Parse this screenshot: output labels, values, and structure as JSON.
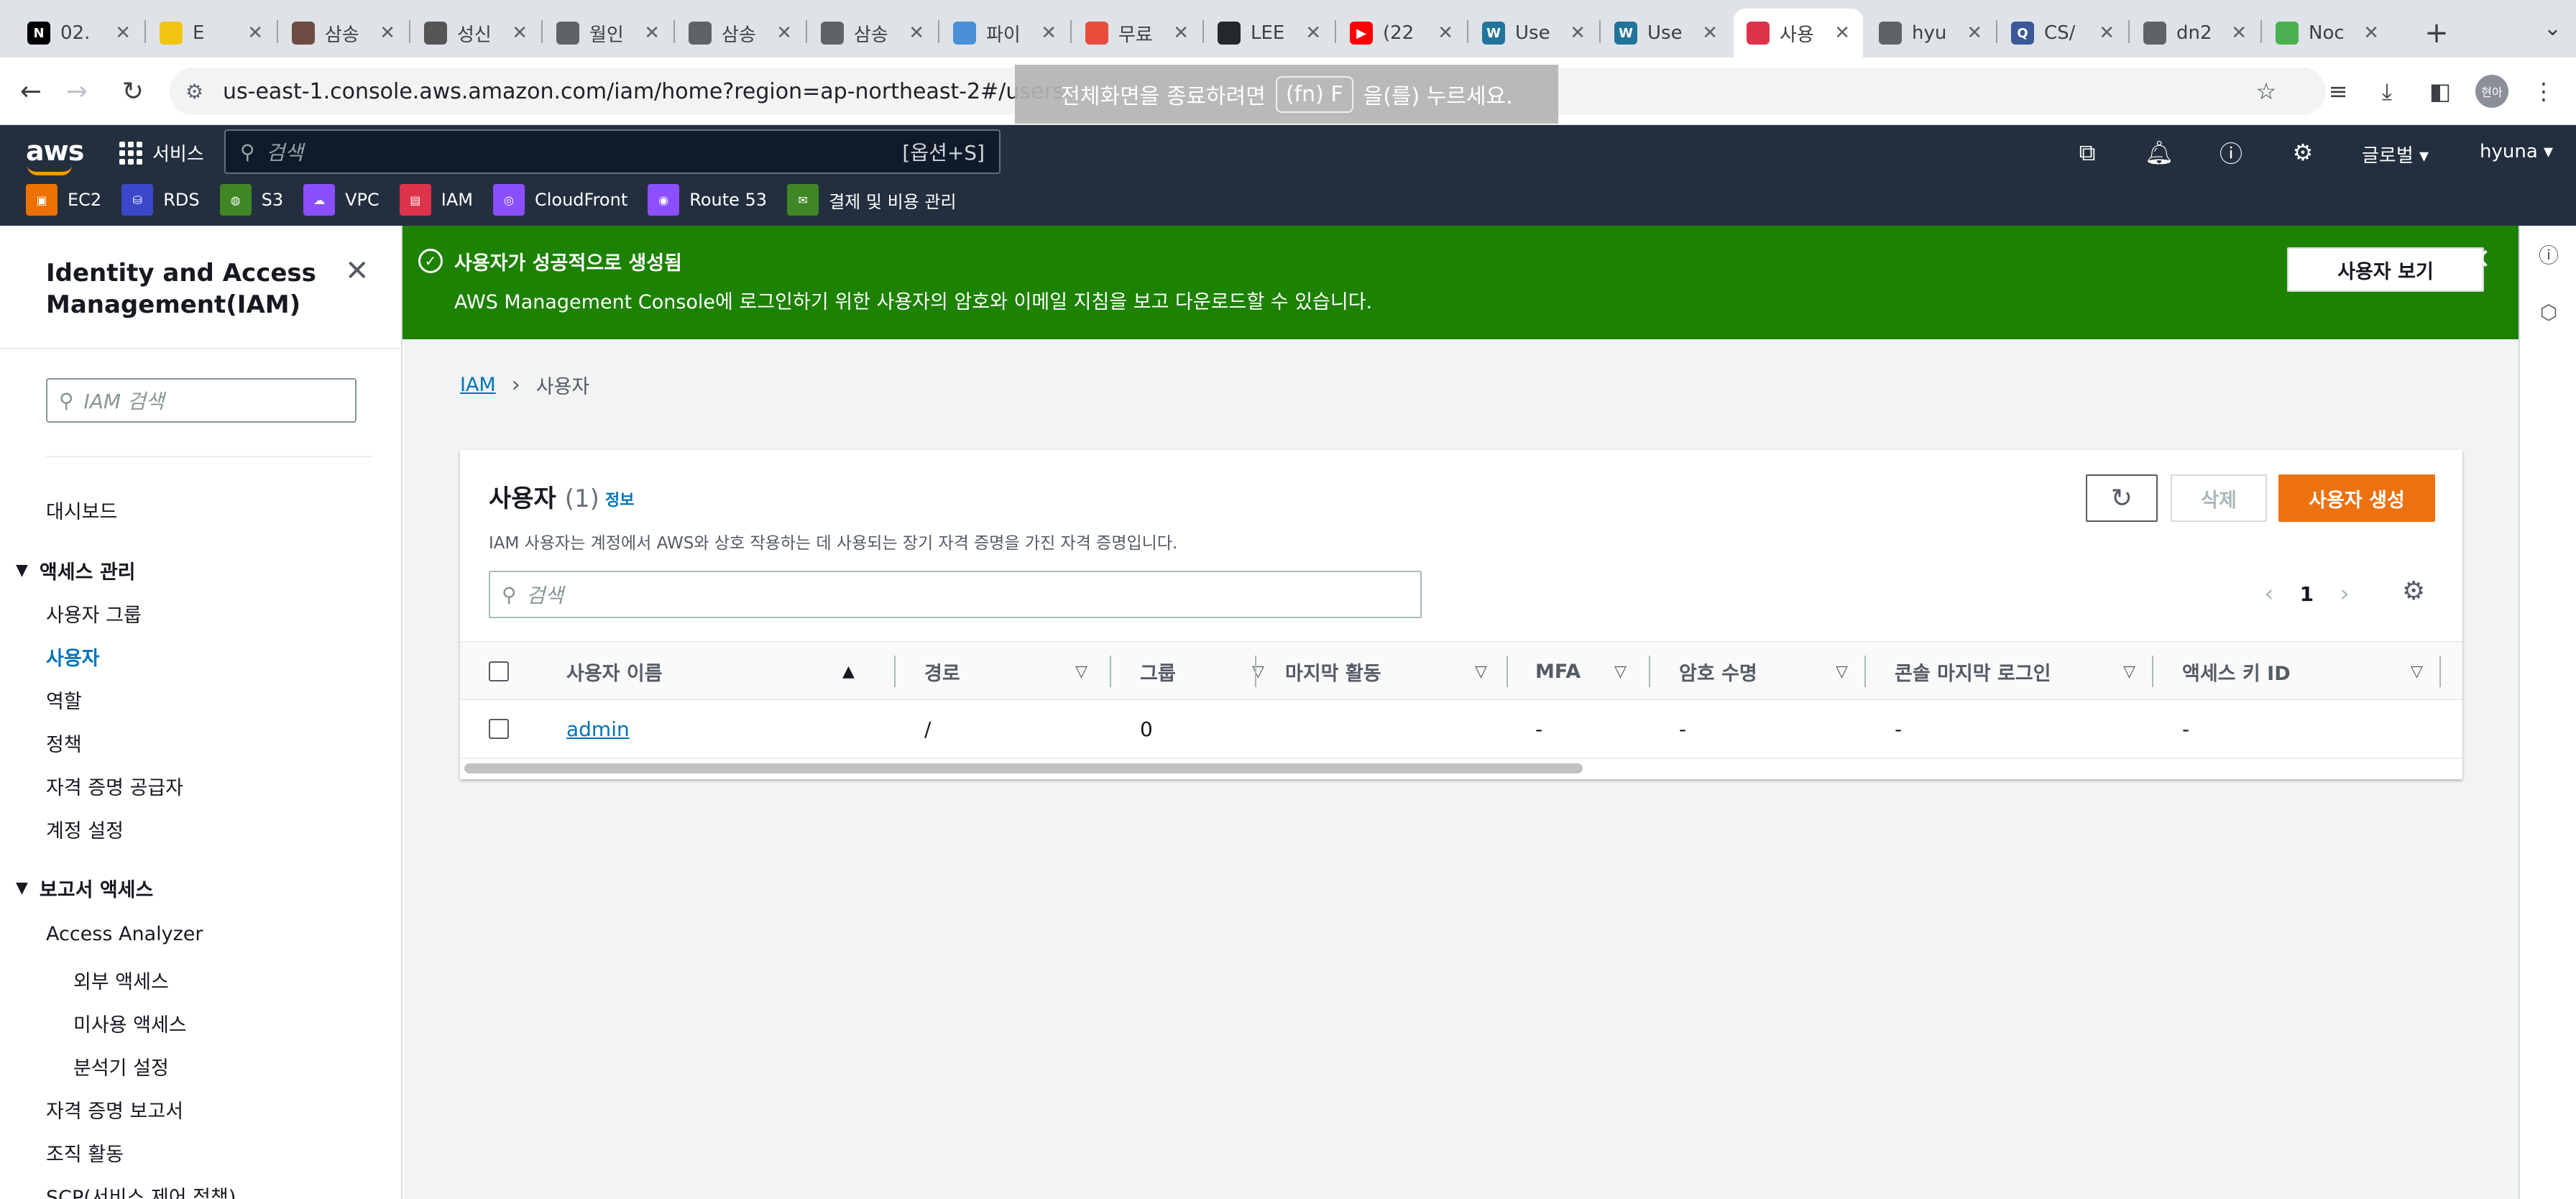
{
  "browser": {
    "tabs": [
      {
        "title": "02.",
        "icon_color": "#000000",
        "icon_label": "N"
      },
      {
        "title": "E",
        "icon_color": "#f1c40f",
        "icon_label": ""
      },
      {
        "title": "삼송",
        "icon_color": "#6d4c41",
        "icon_label": ""
      },
      {
        "title": "성신",
        "icon_color": "#555555",
        "icon_label": ""
      },
      {
        "title": "월인",
        "icon_color": "#5f6368",
        "icon_label": ""
      },
      {
        "title": "삼송",
        "icon_color": "#5f6368",
        "icon_label": ""
      },
      {
        "title": "삼송",
        "icon_color": "#5f6368",
        "icon_label": ""
      },
      {
        "title": "파이",
        "icon_color": "#4a90d9",
        "icon_label": ""
      },
      {
        "title": "무료",
        "icon_color": "#e74c3c",
        "icon_label": ""
      },
      {
        "title": "LEE",
        "icon_color": "#24292e",
        "icon_label": ""
      },
      {
        "title": "(22",
        "icon_color": "#ff0000",
        "icon_label": "▶"
      },
      {
        "title": "Use",
        "icon_color": "#21759b",
        "icon_label": "W"
      },
      {
        "title": "Use",
        "icon_color": "#21759b",
        "icon_label": "W"
      },
      {
        "title": "사용",
        "icon_color": "#dd344c",
        "icon_label": ""
      },
      {
        "title": "hyu",
        "icon_color": "#5f6368",
        "icon_label": ""
      },
      {
        "title": "CS/",
        "icon_color": "#3b5998",
        "icon_label": "Q"
      },
      {
        "title": "dn2",
        "icon_color": "#5f6368",
        "icon_label": ""
      },
      {
        "title": "Noc",
        "icon_color": "#4caf50",
        "icon_label": ""
      }
    ],
    "new_tab_label": "+",
    "url": "us-east-1.console.aws.amazon.com/iam/home?region=ap-northeast-2#/users",
    "fullscreen_hint": {
      "before": "전체화면을 종료하려면",
      "key": "(fn) F",
      "after": "을(를) 누르세요."
    },
    "profile_initials": "현아"
  },
  "aws_nav": {
    "logo": "aws",
    "services_label": "서비스",
    "search_placeholder": "검색",
    "search_shortcut": "[옵션+S]",
    "region_label": "글로벌",
    "user_label": "hyuna",
    "favorites": [
      {
        "label": "EC2",
        "color": "#ed7100"
      },
      {
        "label": "RDS",
        "color": "#3b48cc"
      },
      {
        "label": "S3",
        "color": "#3f8624"
      },
      {
        "label": "VPC",
        "color": "#8c4fff"
      },
      {
        "label": "IAM",
        "color": "#dd344c"
      },
      {
        "label": "CloudFront",
        "color": "#8c4fff"
      },
      {
        "label": "Route 53",
        "color": "#8c4fff"
      },
      {
        "label": "결제 및 비용 관리",
        "color": "#3f8624"
      }
    ]
  },
  "sidebar": {
    "title": "Identity and Access Management(IAM)",
    "search_placeholder": "IAM 검색",
    "dashboard": "대시보드",
    "access_section": "액세스 관리",
    "access_items": [
      "사용자 그룹",
      "사용자",
      "역할",
      "정책",
      "자격 증명 공급자",
      "계정 설정"
    ],
    "active_item": "사용자",
    "reports_section": "보고서 액세스",
    "access_analyzer": "Access Analyzer",
    "analyzer_items": [
      "외부 액세스",
      "미사용 액세스",
      "분석기 설정"
    ],
    "more_items": [
      "자격 증명 보고서",
      "조직 활동",
      "SCP(서비스 제어 정책)"
    ]
  },
  "flash": {
    "title": "사용자가 성공적으로 생성됨",
    "message": "AWS Management Console에 로그인하기 위한 사용자의 암호와 이메일 지침을 보고 다운로드할 수 있습니다.",
    "view_button": "사용자 보기",
    "color": "#1d8102"
  },
  "breadcrumb": {
    "root": "IAM",
    "current": "사용자"
  },
  "users_panel": {
    "title": "사용자",
    "count": "(1)",
    "info_link": "정보",
    "description": "IAM 사용자는 계정에서 AWS와 상호 작용하는 데 사용되는 장기 자격 증명을 가진 자격 증명입니다.",
    "delete_button": "삭제",
    "create_button": "사용자 생성",
    "search_placeholder": "검색",
    "page_number": "1",
    "columns": [
      "사용자 이름",
      "경로",
      "그룹",
      "마지막 활동",
      "MFA",
      "암호 수명",
      "콘솔 마지막 로그인",
      "액세스 키 ID"
    ],
    "rows": [
      {
        "user_name": "admin",
        "path": "/",
        "groups": "0",
        "last_activity": "",
        "mfa": "-",
        "password_age": "-",
        "console_last_signin": "-",
        "access_key_id": "-"
      }
    ]
  }
}
